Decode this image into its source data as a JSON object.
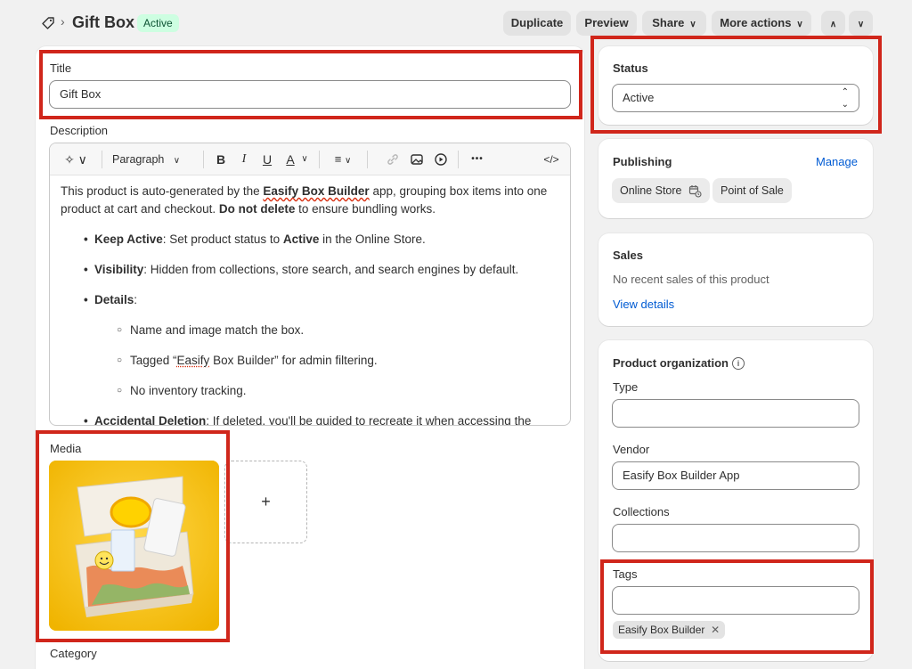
{
  "header": {
    "title": "Gift Box",
    "status_badge": "Active",
    "buttons": {
      "duplicate": "Duplicate",
      "preview": "Preview",
      "share": "Share",
      "more_actions": "More actions"
    }
  },
  "title_field": {
    "label": "Title",
    "value": "Gift Box"
  },
  "description": {
    "label": "Description",
    "toolbar": {
      "paragraph_label": "Paragraph",
      "bold": "B",
      "italic": "I",
      "underline": "U",
      "text_color": "A",
      "more": "•••",
      "code": "</>"
    },
    "intro_1": "This product is auto-generated by the ",
    "intro_app": "Easify Box Builder",
    "intro_2": " app, grouping box items into one product at cart and checkout. ",
    "intro_dnd": "Do not delete",
    "intro_3": " to ensure bundling works.",
    "keep_active_label": "Keep Active",
    "keep_active_text_1": ": Set product status to ",
    "keep_active_bold": "Active",
    "keep_active_text_2": " in the Online Store.",
    "visibility_label": "Visibility",
    "visibility_text": ": Hidden from collections, store search, and search engines by default.",
    "details_label": "Details",
    "details_colon": ":",
    "sub_1": "Name and image match the box.",
    "sub_2_a": "Tagged “",
    "sub_2_word": "Easify",
    "sub_2_b": " Box Builder” for admin filtering.",
    "sub_3": "No inventory tracking.",
    "accidental_label": "Accidental Deletion",
    "accidental_text": ": If deleted, you'll be guided to recreate it when accessing the"
  },
  "media": {
    "label": "Media",
    "add_symbol": "+"
  },
  "category": {
    "label": "Category"
  },
  "status_card": {
    "label": "Status",
    "value": "Active"
  },
  "publishing": {
    "label": "Publishing",
    "manage": "Manage",
    "channels": [
      "Online Store",
      "Point of Sale"
    ]
  },
  "sales": {
    "label": "Sales",
    "note": "No recent sales of this product",
    "link": "View details"
  },
  "organization": {
    "label": "Product organization",
    "type_label": "Type",
    "type_value": "",
    "vendor_label": "Vendor",
    "vendor_value": "Easify Box Builder App",
    "collections_label": "Collections",
    "collections_value": "",
    "tags_label": "Tags",
    "tags_value": "",
    "tags": [
      "Easify Box Builder"
    ]
  },
  "colors": {
    "accent_link": "#005bd3",
    "badge_bg": "#cdfee1",
    "badge_text": "#0c5132",
    "highlight_red": "#d0261b"
  }
}
